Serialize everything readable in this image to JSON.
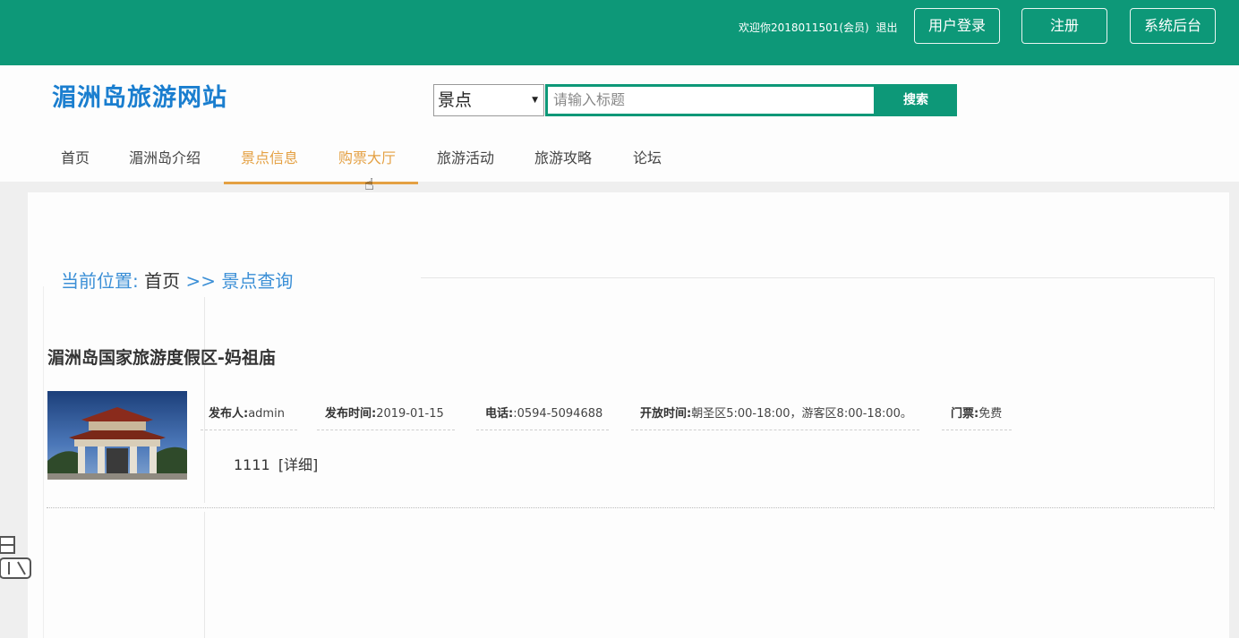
{
  "topbar": {
    "welcome": "欢迎你2018011501(会员)",
    "logout": "退出",
    "login_button": "用户登录",
    "register_button": "注册",
    "admin_button": "系统后台"
  },
  "header": {
    "site_title": "湄洲岛旅游网站",
    "search": {
      "category": "景点",
      "placeholder": "请输入标题",
      "button": "搜索"
    }
  },
  "nav": {
    "items": [
      {
        "label": "首页"
      },
      {
        "label": "湄洲岛介绍"
      },
      {
        "label": "景点信息"
      },
      {
        "label": "购票大厅"
      },
      {
        "label": "旅游活动"
      },
      {
        "label": "旅游攻略"
      },
      {
        "label": "论坛"
      }
    ]
  },
  "breadcrumb": {
    "prefix": "当前位置:",
    "home": "首页",
    "separator": ">>",
    "current": "景点查询"
  },
  "attraction": {
    "title": "湄洲岛国家旅游度假区-妈祖庙",
    "publisher_label": "发布人:",
    "publisher": "admin",
    "date_label": "发布时间:",
    "date": "2019-01-15",
    "phone_label": "电话:",
    "phone": ":0594-5094688",
    "hours_label": "开放时间:",
    "hours": "朝圣区5:00-18:00，游客区8:00-18:00。",
    "ticket_label": "门票:",
    "ticket": "免费",
    "summary": "1111",
    "detail_link": "[详细]"
  },
  "colors": {
    "primary": "#0d9878",
    "logo": "#1a7ecf",
    "active_nav": "#e4a042",
    "breadcrumb": "#3b8fd6"
  }
}
